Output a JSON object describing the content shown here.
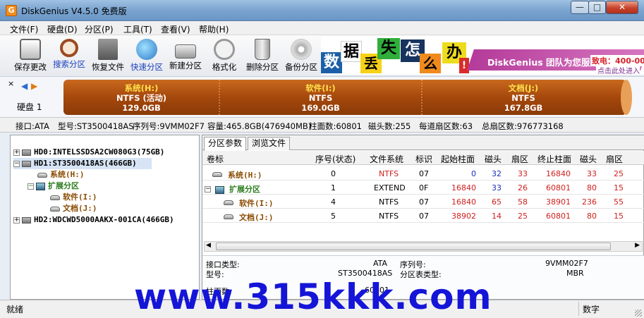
{
  "window": {
    "title": "DiskGenius V4.5.0 免费版",
    "app_icon": "G"
  },
  "menu": [
    "文件(F)",
    "硬盘(D)",
    "分区(P)",
    "工具(T)",
    "查看(V)",
    "帮助(H)"
  ],
  "toolbar": [
    {
      "label": "保存更改",
      "icon": "save-icon"
    },
    {
      "label": "搜索分区",
      "icon": "search-partition-icon"
    },
    {
      "label": "恢复文件",
      "icon": "recover-file-icon"
    },
    {
      "label": "快速分区",
      "icon": "quick-partition-icon"
    },
    {
      "label": "新建分区",
      "icon": "new-partition-icon"
    },
    {
      "label": "格式化",
      "icon": "format-icon"
    },
    {
      "label": "删除分区",
      "icon": "delete-partition-icon"
    },
    {
      "label": "备份分区",
      "icon": "backup-partition-icon"
    }
  ],
  "banner": {
    "tiles": [
      "数",
      "据",
      "丢",
      "失",
      "怎",
      "么",
      "办",
      "!"
    ],
    "slogan": "DiskGenius 团队为您服务",
    "phone": "致电：400-00",
    "link": "点击此处进入"
  },
  "disk_map": {
    "disk_label": "硬盘 1",
    "partitions": [
      {
        "name": "系统(H:)",
        "fs": "NTFS (活动)",
        "size": "129.0GB"
      },
      {
        "name": "软件(I:)",
        "fs": "NTFS",
        "size": "169.0GB"
      },
      {
        "name": "文档(J:)",
        "fs": "NTFS",
        "size": "167.8GB"
      }
    ]
  },
  "disk_info": {
    "interface": "接口:ATA",
    "model": "型号:ST3500418AS",
    "serial": "序列号:9VMM02F7",
    "capacity": "容量:465.8GB(476940MB)",
    "cylinders": "柱面数:60801",
    "heads": "磁头数:255",
    "sectors_per_track": "每道扇区数:63",
    "total_sectors": "总扇区数:976773168"
  },
  "tree": [
    {
      "label": "HD0:INTELSSDSA2CW080G3(75GB)"
    },
    {
      "label": "HD1:ST3500418AS(466GB)"
    },
    {
      "label": "系统(H:)"
    },
    {
      "label": "扩展分区"
    },
    {
      "label": "软件(I:)"
    },
    {
      "label": "文档(J:)"
    },
    {
      "label": "HD2:WDCWD5000AAKX-001CA(466GB)"
    }
  ],
  "tabs": [
    "分区参数",
    "浏览文件"
  ],
  "table": {
    "headers": [
      "卷标",
      "序号(状态)",
      "文件系统",
      "标识",
      "起始柱面",
      "磁头",
      "扇区",
      "终止柱面",
      "磁头",
      "扇区"
    ],
    "rows": [
      [
        "系统(H:)",
        "0",
        "NTFS",
        "07",
        "0",
        "32",
        "33",
        "16840",
        "33",
        "25"
      ],
      [
        "扩展分区",
        "1",
        "EXTEND",
        "0F",
        "16840",
        "33",
        "26",
        "60801",
        "80",
        "15"
      ],
      [
        "软件(I:)",
        "4",
        "NTFS",
        "07",
        "16840",
        "65",
        "58",
        "38901",
        "236",
        "55"
      ],
      [
        "文档(J:)",
        "5",
        "NTFS",
        "07",
        "38902",
        "14",
        "25",
        "60801",
        "80",
        "15"
      ]
    ]
  },
  "details": {
    "interface_label": "接口类型:",
    "interface_value": "ATA",
    "serial_label": "序列号:",
    "serial_value": "9VMM02F7",
    "model_label": "型号:",
    "model_value": "ST3500418AS",
    "table_type_label": "分区表类型:",
    "table_type_value": "MBR",
    "cyl_label": "柱面数:",
    "cyl_value": "60801"
  },
  "status": {
    "left": "就绪",
    "right": "数字"
  },
  "watermark": "www.315kkk.com"
}
